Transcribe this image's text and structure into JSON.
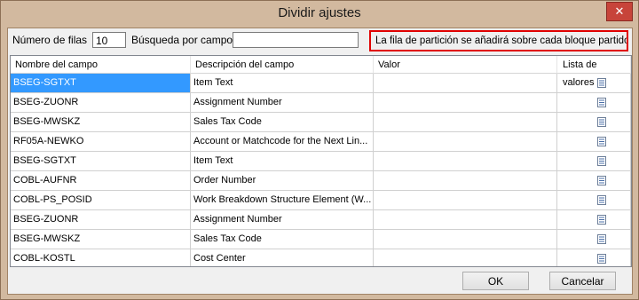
{
  "window": {
    "title": "Dividir ajustes",
    "close_glyph": "✕"
  },
  "toolbar": {
    "rows_label": "Número de filas",
    "rows_value": "10",
    "search_label": "Búsqueda por campos",
    "search_value": "",
    "notice": "La fila de partición se añadirá sobre cada bloque partido."
  },
  "grid": {
    "columns": [
      "Nombre del campo",
      "Descripción del campo",
      "Valor",
      "Lista de valores"
    ],
    "rows": [
      {
        "name": "BSEG-SGTXT",
        "desc": "Item Text",
        "value": ""
      },
      {
        "name": "BSEG-ZUONR",
        "desc": "Assignment Number",
        "value": ""
      },
      {
        "name": "BSEG-MWSKZ",
        "desc": "Sales Tax Code",
        "value": ""
      },
      {
        "name": "RF05A-NEWKO",
        "desc": "Account or Matchcode for the Next Lin...",
        "value": ""
      },
      {
        "name": "BSEG-SGTXT",
        "desc": "Item Text",
        "value": ""
      },
      {
        "name": "COBL-AUFNR",
        "desc": "Order Number",
        "value": ""
      },
      {
        "name": "COBL-PS_POSID",
        "desc": "Work Breakdown Structure Element (W...",
        "value": ""
      },
      {
        "name": "BSEG-ZUONR",
        "desc": "Assignment Number",
        "value": ""
      },
      {
        "name": "BSEG-MWSKZ",
        "desc": "Sales Tax Code",
        "value": ""
      },
      {
        "name": "COBL-KOSTL",
        "desc": "Cost Center",
        "value": ""
      }
    ],
    "selected_row": 0,
    "value_list_icon": "list-icon"
  },
  "footer": {
    "ok_label": "OK",
    "cancel_label": "Cancelar"
  },
  "colors": {
    "title_bg": "#d2b99f",
    "selection": "#3399ff",
    "notice_border": "#e00000",
    "close_bg": "#c7443a"
  }
}
